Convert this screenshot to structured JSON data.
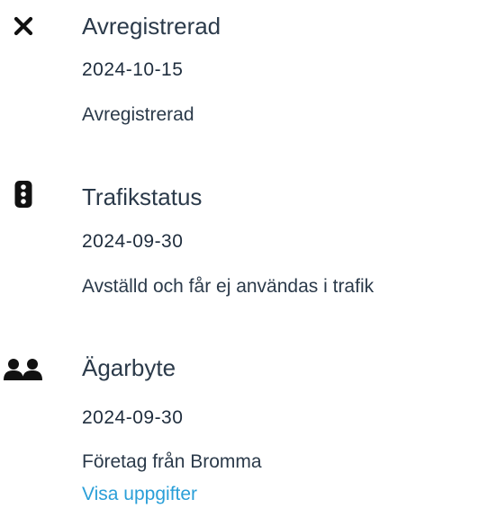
{
  "events": [
    {
      "icon": "close-icon",
      "title": "Avregistrerad",
      "date": "2024-10-15",
      "description": "Avregistrerad"
    },
    {
      "icon": "traffic-light-icon",
      "title": "Trafikstatus",
      "date": "2024-09-30",
      "description": "Avställd och får ej användas i trafik"
    },
    {
      "icon": "users-icon",
      "title": "Ägarbyte",
      "date": "2024-09-30",
      "description": "Företag från Bromma",
      "link": "Visa uppgifter"
    }
  ],
  "colors": {
    "text": "#2b3a4a",
    "link": "#2a9fd8",
    "icon": "#111111"
  }
}
